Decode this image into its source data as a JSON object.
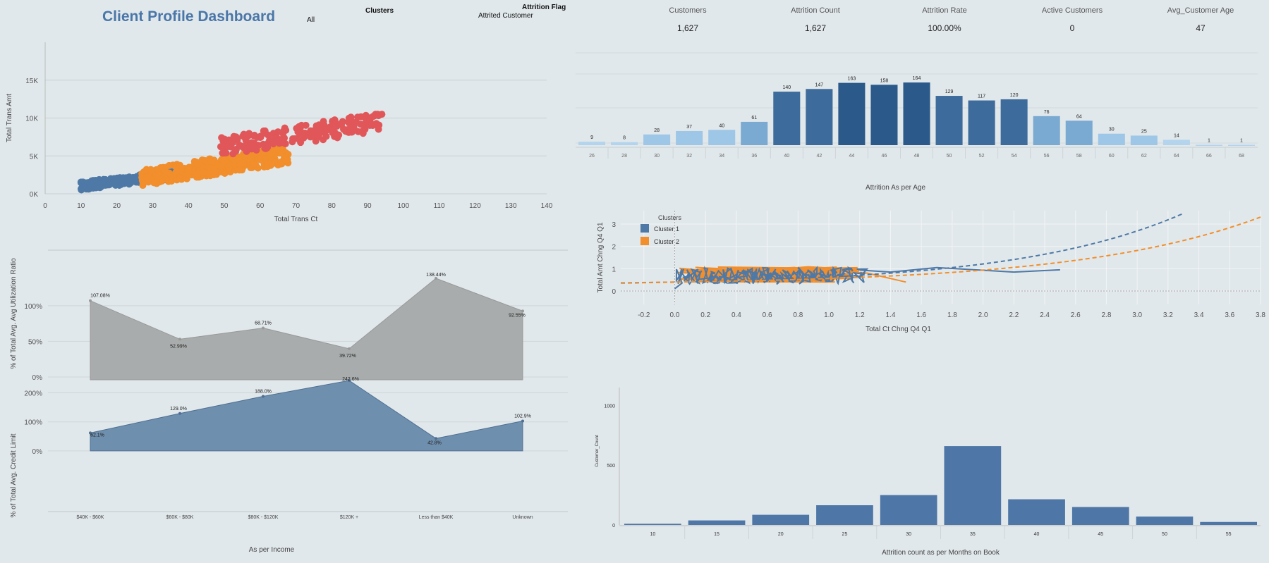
{
  "header": {
    "title": "Client Profile Dashboard",
    "filter_all": "All",
    "clusters_label": "Clusters",
    "attrition_flag_label": "Attrition Flag",
    "attrition_flag_value": "Attrited Customer"
  },
  "kpis": [
    {
      "label": "Customers",
      "value": "1,627"
    },
    {
      "label": "Attrition Count",
      "value": "1,627"
    },
    {
      "label": "Attrition Rate",
      "value": "100.00%"
    },
    {
      "label": "Active Customers",
      "value": "0"
    },
    {
      "label": "Avg_Customer Age",
      "value": "47"
    }
  ],
  "colors": {
    "blue": "#4e79a7",
    "orange": "#f28e2b",
    "red": "#e15759",
    "gray": "#a9acac",
    "income_blue": "#5b7fa3",
    "grid": "#c9d1d5",
    "bg": "#e1e8eb"
  },
  "chart_data": [
    {
      "id": "scatter",
      "type": "scatter",
      "xlabel": "Total Trans Ct",
      "ylabel": "Total Trans Amt",
      "xlim": [
        0,
        140
      ],
      "ylim": [
        0,
        20000
      ],
      "x_ticks": [
        "0",
        "10",
        "20",
        "30",
        "40",
        "50",
        "60",
        "70",
        "80",
        "90",
        "100",
        "110",
        "120",
        "130",
        "140"
      ],
      "y_ticks": [
        "0K",
        "5K",
        "10K",
        "15K"
      ],
      "clusters": [
        {
          "color": "#4e79a7",
          "x_range": [
            10,
            37
          ],
          "y_range": [
            500,
            3000
          ]
        },
        {
          "color": "#f28e2b",
          "x_range": [
            27,
            68
          ],
          "y_range": [
            1000,
            6000
          ]
        },
        {
          "color": "#e15759",
          "x_range": [
            49,
            94
          ],
          "y_range": [
            5000,
            10500
          ]
        }
      ]
    },
    {
      "id": "age_bars",
      "type": "bar",
      "xlabel": "Attrition As per Age",
      "categories": [
        "26",
        "28",
        "30",
        "32",
        "34",
        "36",
        "40",
        "42",
        "44",
        "46",
        "48",
        "50",
        "52",
        "54",
        "56",
        "58",
        "60",
        "62",
        "64",
        "66",
        "68"
      ],
      "values": [
        9,
        8,
        28,
        37,
        40,
        61,
        140,
        147,
        163,
        158,
        164,
        129,
        117,
        120,
        76,
        64,
        30,
        25,
        14,
        1,
        1
      ],
      "ylim": [
        0,
        260
      ]
    },
    {
      "id": "util_area",
      "type": "area",
      "ylabel": "% of Total Avg. Avg Utilization Ratio",
      "categories": [
        "$40K - $60K",
        "$60K - $80K",
        "$80K - $120K",
        "$120K +",
        "Less than $40K",
        "Unknown"
      ],
      "values": [
        107.08,
        52.99,
        68.71,
        39.72,
        138.44,
        92.55
      ],
      "labels": [
        "107.08%",
        "52.99%",
        "68.71%",
        "39.72%",
        "138.44%",
        "92.55%"
      ],
      "y_ticks": [
        "0%",
        "50%",
        "100%"
      ],
      "ylim": [
        0,
        150
      ]
    },
    {
      "id": "credit_area",
      "type": "area",
      "ylabel": "% of Total Avg. Credit Limit",
      "xlabel": "As per Income",
      "categories": [
        "$40K - $60K",
        "$60K - $80K",
        "$80K - $120K",
        "$120K +",
        "Less than $40K",
        "Unknown"
      ],
      "values": [
        62.1,
        129.0,
        188.0,
        242.6,
        42.8,
        102.9
      ],
      "labels": [
        "62.1%",
        "129.0%",
        "188.0%",
        "242.6%",
        "42.8%",
        "102.9%"
      ],
      "y_ticks": [
        "0%",
        "100%",
        "200%"
      ],
      "ylim": [
        -90,
        245
      ]
    },
    {
      "id": "chng_scatter",
      "type": "line",
      "xlabel": "Total Ct Chng Q4 Q1",
      "ylabel": "Total Amt Chng Q4 Q1",
      "xlim": [
        -0.35,
        3.8
      ],
      "ylim": [
        -0.6,
        3.6
      ],
      "x_ticks": [
        "-0.2",
        "0.0",
        "0.2",
        "0.4",
        "0.6",
        "0.8",
        "1.0",
        "1.2",
        "1.4",
        "1.6",
        "1.8",
        "2.0",
        "2.2",
        "2.4",
        "2.6",
        "2.8",
        "3.0",
        "3.2",
        "3.4",
        "3.6",
        "3.8"
      ],
      "y_ticks": [
        "0",
        "1",
        "2",
        "3"
      ],
      "legend_title": "Clusters",
      "series": [
        {
          "name": "Cluster 1",
          "color": "#4e79a7"
        },
        {
          "name": "Cluster 2",
          "color": "#f28e2b"
        }
      ]
    },
    {
      "id": "months_bars",
      "type": "bar",
      "xlabel": "Attrition count as per Months on Book",
      "ylabel": "Customer_Count",
      "categories": [
        "10",
        "15",
        "20",
        "25",
        "30",
        "35",
        "40",
        "45",
        "50",
        "55"
      ],
      "values": [
        10,
        38,
        85,
        165,
        250,
        660,
        215,
        150,
        70,
        25
      ],
      "y_ticks": [
        "0",
        "500",
        "1000"
      ],
      "ylim": [
        0,
        1150
      ]
    }
  ]
}
